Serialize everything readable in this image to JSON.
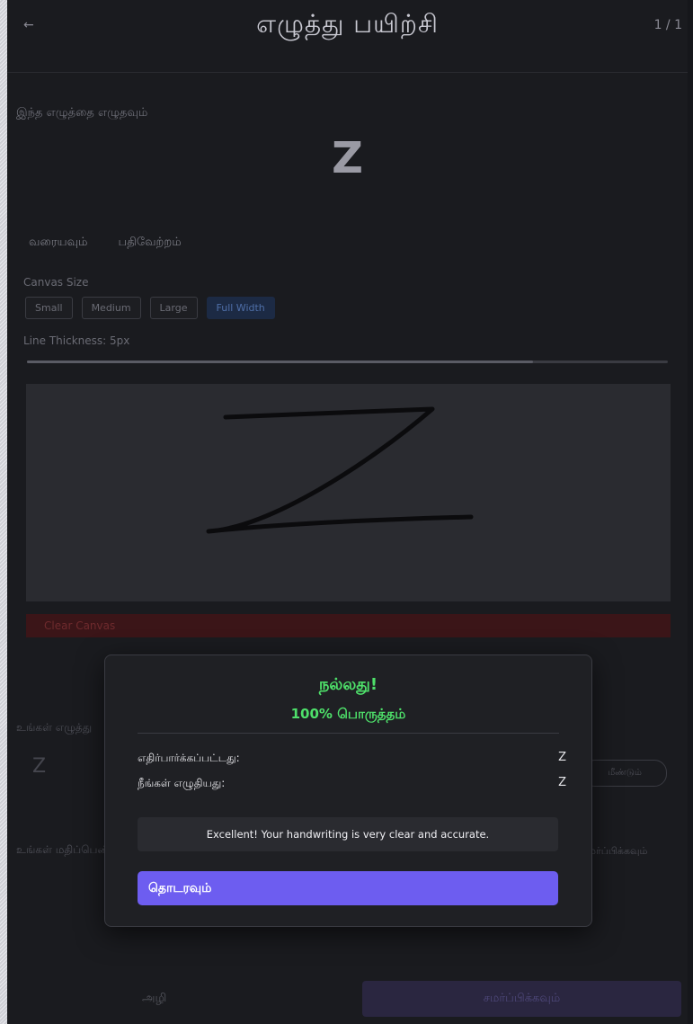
{
  "header": {
    "back_label": "←",
    "title": "எழுத்து பயிற்சி",
    "score": "1 / 1",
    "sub": "—"
  },
  "practice": {
    "instruction": "இந்த எழுத்தை எழுதவும்",
    "target_letter": "Z"
  },
  "tabs": [
    {
      "label": "வரையவும்"
    },
    {
      "label": "பதிவேற்றம்"
    }
  ],
  "canvas_settings": {
    "size_label": "Canvas Size",
    "sizes": [
      "Small",
      "Medium",
      "Large",
      "Full Width"
    ],
    "active_size": "Full Width",
    "thickness_label": "Line Thickness: 5px",
    "thickness_fraction": 0.79,
    "clear_label": "Clear Canvas"
  },
  "drawing": {
    "stroke_color": "#0b0b0d"
  },
  "background": {
    "recognized_label": "உங்கள் எழுத்து",
    "recognized_letter": "Z",
    "pill_label": "மீண்டும்",
    "second_label": "உங்கள் மதிப்பெண்",
    "second_right": "சமர்ப்பிக்கவும்"
  },
  "footer": {
    "left_label": "அழி",
    "right_label": "சமர்ப்பிக்கவும்"
  },
  "modal": {
    "title": "நல்லது!",
    "match": "100% பொருத்தம்",
    "expected_label": "எதிர்பார்க்கப்பட்டது:",
    "expected_value": "Z",
    "yours_label": "நீங்கள் எழுதியது:",
    "yours_value": "Z",
    "feedback": "Excellent! Your handwriting is very clear and accurate.",
    "continue_label": "தொடரவும்"
  },
  "colors": {
    "success": "#4ee06a",
    "primary": "#6d5df0",
    "danger_dim": "#3b1518"
  }
}
